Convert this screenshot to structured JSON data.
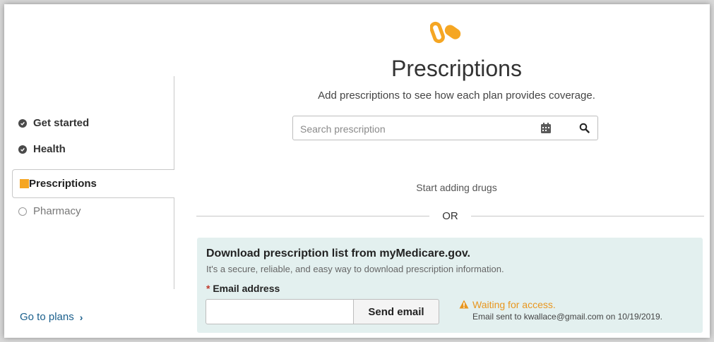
{
  "sidebar": {
    "items": [
      {
        "label": "Get started",
        "status": "done"
      },
      {
        "label": "Health",
        "status": "done"
      },
      {
        "label": "Prescriptions",
        "status": "active"
      },
      {
        "label": "Pharmacy",
        "status": "pending"
      }
    ],
    "go_to_plans": "Go to plans",
    "go_to_plans_icon": "chevron-right-icon"
  },
  "header": {
    "logo_icon": "pills-icon",
    "title": "Prescriptions",
    "subtitle": "Add prescriptions to see how each plan provides coverage."
  },
  "search": {
    "placeholder": "Search prescription",
    "value": "",
    "icons": [
      "calendar-icon",
      "search-icon"
    ]
  },
  "main": {
    "empty_text": "Start adding drugs",
    "divider_text": "OR"
  },
  "download_panel": {
    "heading": "Download prescription list from myMedicare.gov.",
    "description": "It's a secure, reliable, and easy way to download prescription information.",
    "required_mark": "*",
    "email_label": "Email address",
    "email_value": "",
    "send_button": "Send email",
    "status_icon": "warning-icon",
    "status_text": "Waiting for access.",
    "status_detail": "Email sent to kwallace@gmail.com on 10/19/2019."
  },
  "colors": {
    "accent": "#f5a623",
    "link": "#1a5f8c",
    "panel_bg": "#e3f0ef",
    "warning": "#e8961e"
  }
}
